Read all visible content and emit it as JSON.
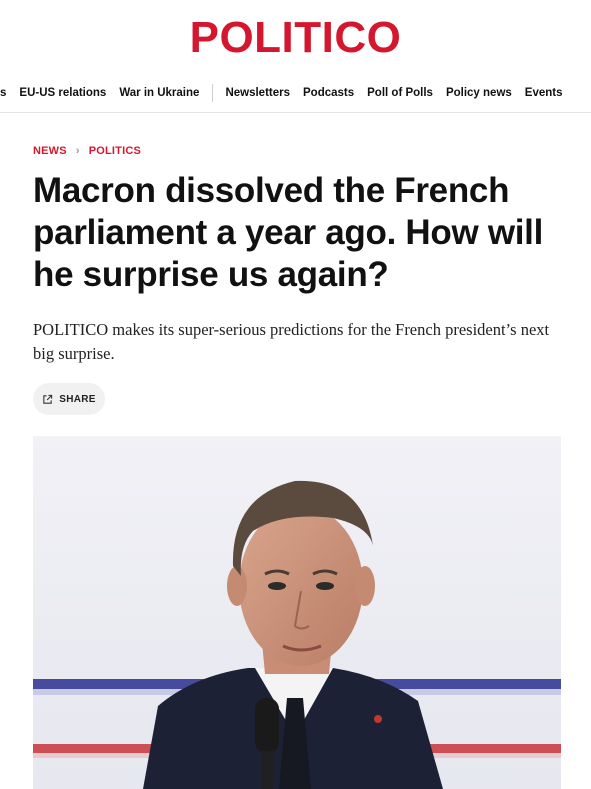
{
  "brand": {
    "logo": "POLITICO",
    "color": "#d4172f"
  },
  "nav": {
    "items": [
      "s",
      "EU-US relations",
      "War in Ukraine"
    ],
    "items_after_divider": [
      "Newsletters",
      "Podcasts",
      "Poll of Polls",
      "Policy news",
      "Events"
    ]
  },
  "breadcrumb": {
    "section": "NEWS",
    "subsection": "POLITICS"
  },
  "article": {
    "headline": "Macron dissolved the French parliament a year ago. How will he surprise us again?",
    "dek": "POLITICO makes its super-serious predictions for the French president’s next big surprise.",
    "share_label": "SHARE"
  },
  "icons": {
    "share": "share-external-icon",
    "breadcrumb_separator": "chevron-right-icon"
  }
}
